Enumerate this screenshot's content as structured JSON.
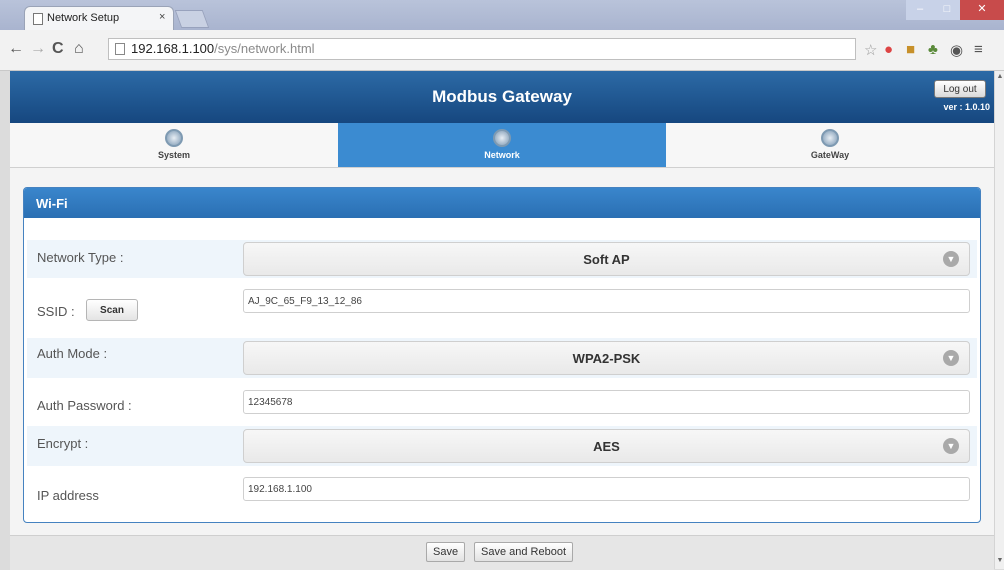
{
  "browser": {
    "tab_title": "Network Setup",
    "tab_close": "×",
    "url_host": "192.168.1.100",
    "url_path": "/sys/network.html"
  },
  "app": {
    "title": "Modbus Gateway",
    "logout_label": "Log out",
    "version": "ver : 1.0.10"
  },
  "nav_tabs": [
    {
      "label": "System",
      "active": false
    },
    {
      "label": "Network",
      "active": true
    },
    {
      "label": "GateWay",
      "active": false
    }
  ],
  "panel": {
    "title": "Wi-Fi",
    "network_type": {
      "label": "Network Type :",
      "value": "Soft AP"
    },
    "ssid": {
      "label": "SSID :",
      "scan_label": "Scan",
      "value": "AJ_9C_65_F9_13_12_86"
    },
    "auth_mode": {
      "label": "Auth Mode :",
      "value": "WPA2-PSK"
    },
    "auth_password": {
      "label": "Auth Password :",
      "value": "12345678"
    },
    "encrypt": {
      "label": "Encrypt :",
      "value": "AES"
    },
    "ip_address": {
      "label": "IP address",
      "value": "192.168.1.100"
    }
  },
  "footer": {
    "save_label": "Save",
    "save_reboot_label": "Save and Reboot"
  },
  "colors": {
    "header_blue": "#1f5a96",
    "active_tab": "#3b8bd1",
    "panel_header": "#2f78bf"
  }
}
